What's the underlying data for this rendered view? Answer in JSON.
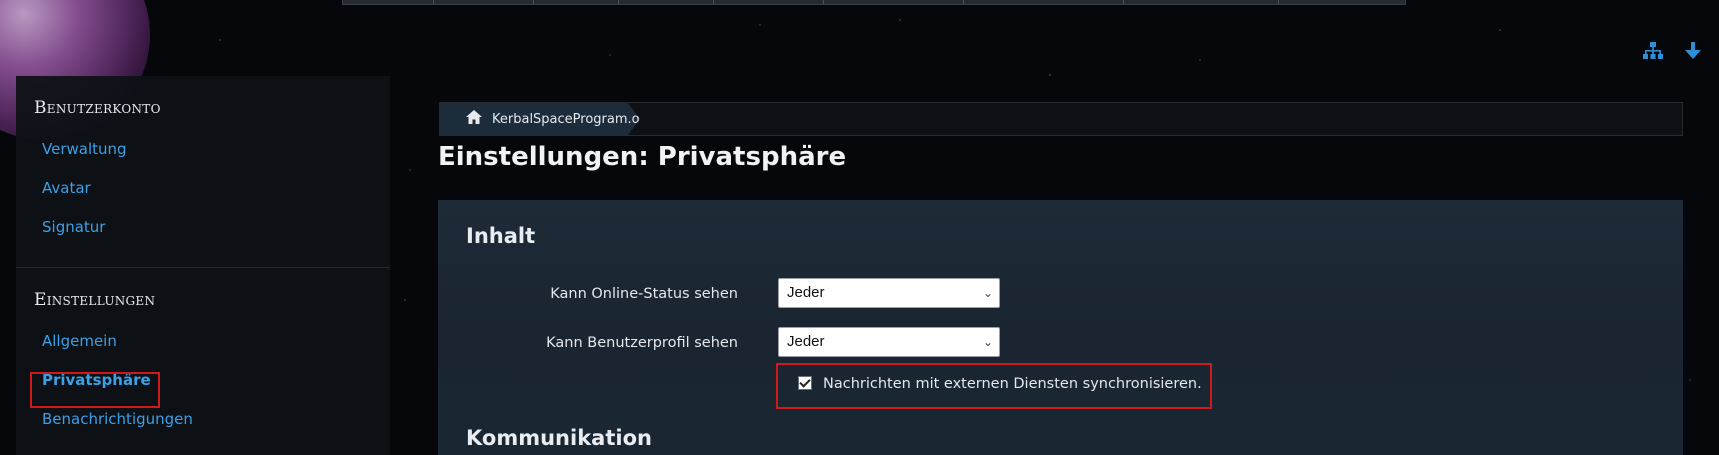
{
  "top_icons": [
    {
      "name": "sitemap-icon",
      "glyph": "⧫"
    },
    {
      "name": "arrow-down-icon",
      "glyph": "↓"
    }
  ],
  "sidebar": {
    "sections": [
      {
        "heading": "Benutzerkonto",
        "items": [
          "Verwaltung",
          "Avatar",
          "Signatur"
        ]
      },
      {
        "heading": "Einstellungen",
        "items": [
          "Allgemein",
          "Privatsphäre",
          "Benachrichtigungen"
        ]
      }
    ],
    "active_item": "Privatsphäre"
  },
  "breadcrumb": {
    "home_label": "KerbalSpaceProgram.de"
  },
  "page_title": "Einstellungen: Privatsphäre",
  "content": {
    "section_title": "Inhalt",
    "fields": [
      {
        "label": "Kann Online-Status sehen",
        "value": "Jeder"
      },
      {
        "label": "Kann Benutzerprofil sehen",
        "value": "Jeder"
      }
    ],
    "checkbox": {
      "label": "Nachrichten mit externen Diensten synchronisieren.",
      "checked": true
    },
    "next_section_title": "Kommunikation"
  },
  "colors": {
    "link": "#3aa0e8",
    "highlight_border": "#d0191b",
    "panel_bg": "#1e2a37"
  }
}
